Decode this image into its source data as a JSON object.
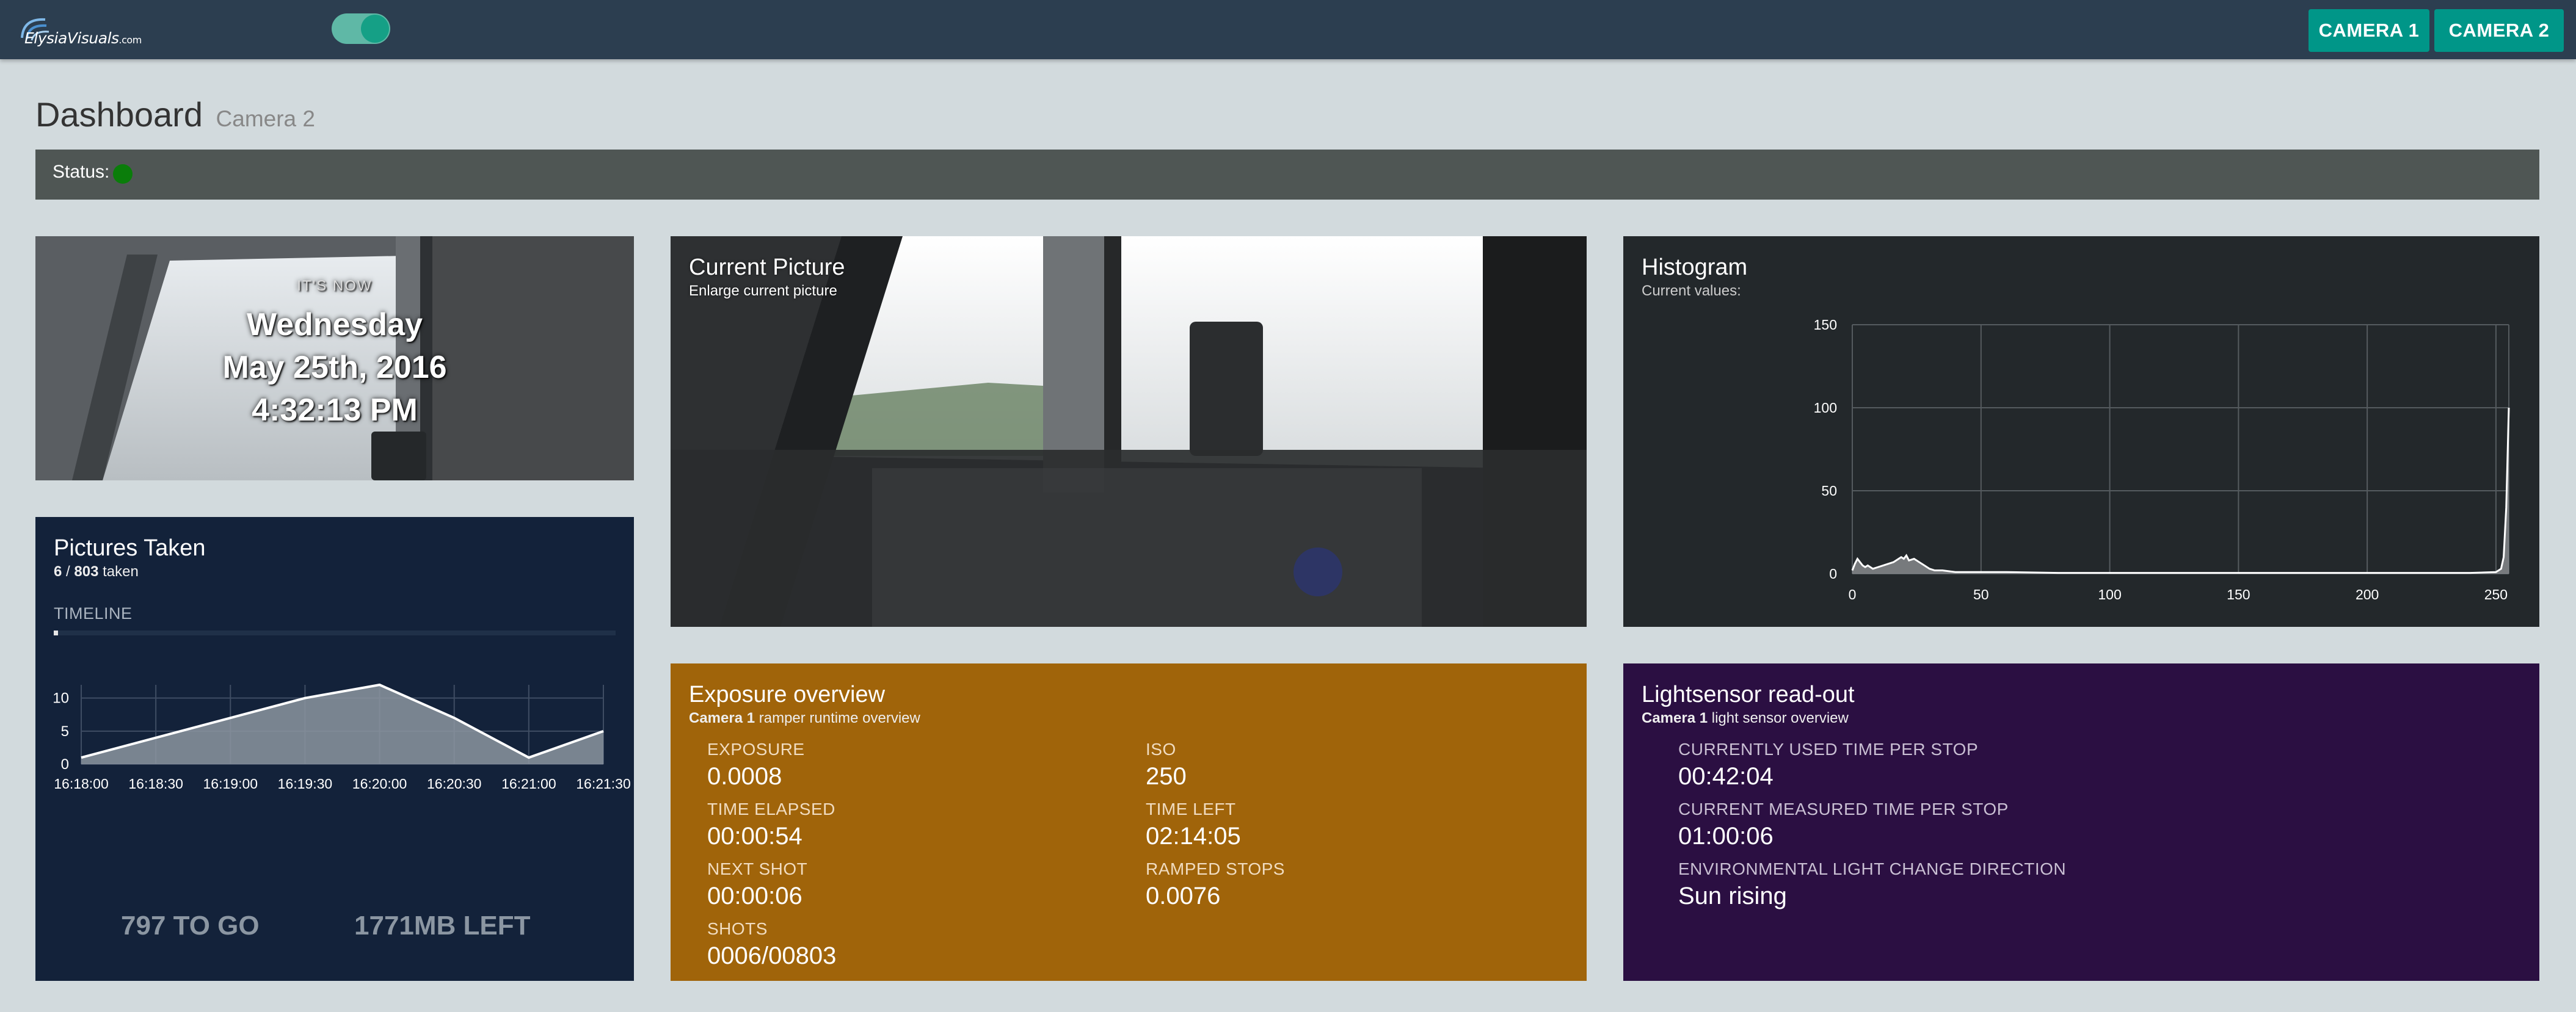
{
  "navbar": {
    "logo_text": "ElysiaVisuals",
    "logo_suffix": ".com",
    "camera1_label": "CAMERA 1",
    "camera2_label": "CAMERA 2"
  },
  "page": {
    "title": "Dashboard",
    "subtitle": "Camera 2"
  },
  "status": {
    "label": "Status:",
    "color": "#0a7d0a"
  },
  "clock": {
    "caption": "IT'S NOW",
    "day": "Wednesday",
    "date": "May 25th, 2016",
    "time": "4:32:13 PM"
  },
  "pictures": {
    "title": "Pictures Taken",
    "count": "6",
    "sep": " / ",
    "total": "803",
    "suffix": " taken",
    "timeline_label": "TIMELINE",
    "timeline_progress": 0.0075,
    "to_go": "797 TO GO",
    "left": "1771MB LEFT"
  },
  "current_picture": {
    "title": "Current Picture",
    "subtitle": "Enlarge current picture"
  },
  "histogram": {
    "title": "Histogram",
    "subtitle": "Current values:"
  },
  "exposure": {
    "title": "Exposure overview",
    "camera": "Camera 1",
    "subtitle_rest": " ramper runtime overview",
    "fields": [
      {
        "label": "EXPOSURE",
        "value": "0.0008"
      },
      {
        "label": "ISO",
        "value": "250"
      },
      {
        "label": "TIME ELAPSED",
        "value": "00:00:54"
      },
      {
        "label": "TIME LEFT",
        "value": "02:14:05"
      },
      {
        "label": "NEXT SHOT",
        "value": "00:00:06"
      },
      {
        "label": "RAMPED STOPS",
        "value": "0.0076"
      },
      {
        "label": "SHOTS",
        "value": "0006/00803"
      }
    ]
  },
  "lightsensor": {
    "title": "Lightsensor read-out",
    "camera": "Camera 1",
    "subtitle_rest": " light sensor overview",
    "fields": [
      {
        "label": "CURRENTLY USED TIME PER STOP",
        "value": "00:42:04"
      },
      {
        "label": "CURRENT MEASURED TIME PER STOP",
        "value": "01:00:06"
      },
      {
        "label": "ENVIRONMENTAL LIGHT CHANGE DIRECTION",
        "value": "Sun rising"
      }
    ]
  },
  "chart_data": [
    {
      "type": "area",
      "x": [
        "16:18:00",
        "16:18:30",
        "16:19:00",
        "16:19:30",
        "16:20:00",
        "16:20:30",
        "16:21:00",
        "16:21:30"
      ],
      "values": [
        1,
        4,
        7,
        10,
        12,
        7,
        1,
        5
      ],
      "x_ticks": [
        "16:18:00",
        "16:18:30",
        "16:19:00",
        "16:19:30",
        "16:20:00",
        "16:20:30",
        "16:21:00",
        "16:21:30"
      ],
      "y_ticks": [
        0,
        5,
        10
      ],
      "ylim": [
        0,
        12
      ],
      "grid": true
    },
    {
      "type": "area",
      "x_ticks": [
        0,
        50,
        100,
        150,
        200,
        250
      ],
      "y_ticks": [
        0,
        50,
        100,
        150
      ],
      "xlim": [
        0,
        255
      ],
      "ylim": [
        0,
        150
      ],
      "grid": true,
      "x": [
        0,
        1,
        2,
        3,
        4,
        5,
        6,
        7,
        8,
        10,
        12,
        14,
        16,
        18,
        19,
        20,
        21,
        22,
        24,
        26,
        28,
        30,
        32,
        35,
        40,
        45,
        50,
        60,
        80,
        120,
        160,
        200,
        240,
        250,
        252,
        253,
        254,
        255
      ],
      "values": [
        2,
        6,
        9,
        7,
        5,
        4,
        5,
        4,
        3,
        4,
        5,
        6,
        7,
        9,
        10,
        9,
        11,
        8,
        9,
        7,
        5,
        3,
        2,
        2,
        1,
        1,
        1,
        1,
        0.5,
        0.5,
        0.5,
        0.5,
        0.5,
        1,
        3,
        10,
        40,
        100
      ]
    }
  ]
}
